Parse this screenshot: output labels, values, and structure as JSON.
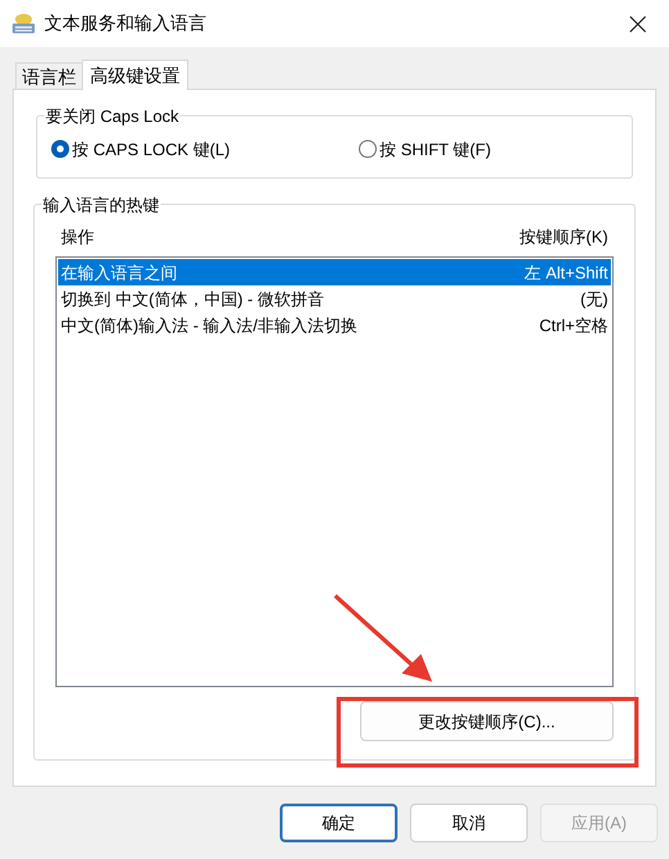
{
  "window": {
    "title": "文本服务和输入语言"
  },
  "tabs": [
    {
      "label": "语言栏",
      "selected": false
    },
    {
      "label": "高级键设置",
      "selected": true
    }
  ],
  "caps_lock_group": {
    "title": "要关闭 Caps Lock",
    "options": [
      {
        "label": "按 CAPS LOCK 键(L)",
        "selected": true
      },
      {
        "label": "按 SHIFT 键(F)",
        "selected": false
      }
    ]
  },
  "hotkeys_group": {
    "title": "输入语言的热键",
    "columns": [
      "操作",
      "按键顺序(K)"
    ],
    "rows": [
      {
        "action": "在输入语言之间",
        "keys": "左 Alt+Shift",
        "selected": true
      },
      {
        "action": "切换到 中文(简体，中国) - 微软拼音",
        "keys": "(无)",
        "selected": false
      },
      {
        "action": "中文(简体)输入法 - 输入法/非输入法切换",
        "keys": "Ctrl+空格",
        "selected": false
      }
    ],
    "change_button": "更改按键顺序(C)..."
  },
  "buttons": [
    {
      "label": "确定",
      "default": true,
      "disabled": false
    },
    {
      "label": "取消",
      "default": false,
      "disabled": false
    },
    {
      "label": "应用(A)",
      "default": false,
      "disabled": true
    }
  ]
}
